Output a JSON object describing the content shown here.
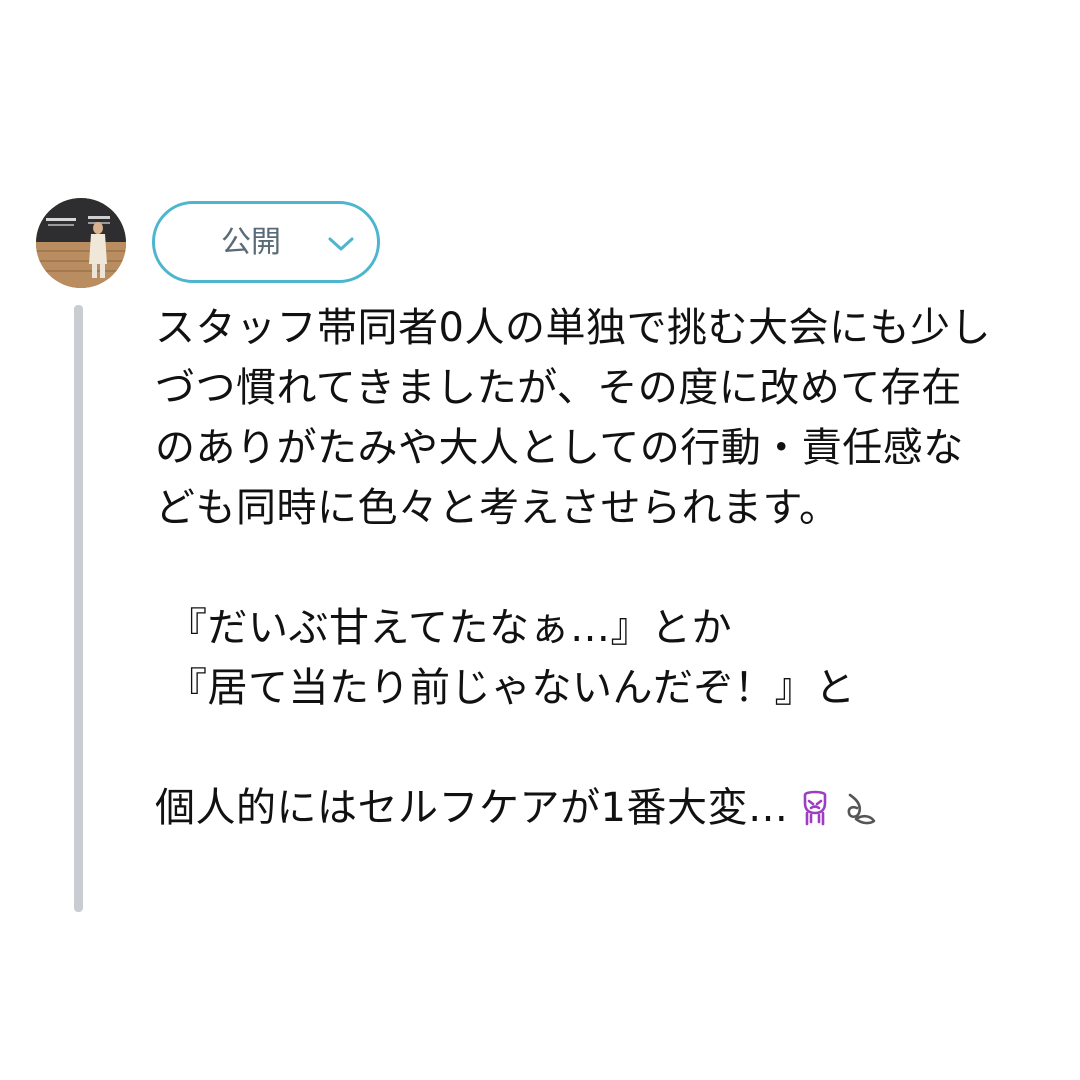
{
  "audience": {
    "label": "公開",
    "accent_color": "#4db6cf",
    "icon": "chevron-down-icon"
  },
  "avatar": {
    "icon": "profile-photo"
  },
  "tweet": {
    "paragraph1": [
      "スタッフ帯同者0人の単独で挑む大会にも少し",
      "づつ慣れてきましたが、その度に改めて存在",
      "のありがたみや大人としての行動・責任感な",
      "ども同時に色々と考えさせられます。"
    ],
    "quote1": "『だいぶ甘えてたなぁ…』とか",
    "quote2": "『居て当たり前じゃないんだぞ！』と",
    "last_line": "個人的にはセルフケアが1番大変…",
    "emojis": [
      "crying-face-icon",
      "sweat-droplets-icon"
    ]
  }
}
